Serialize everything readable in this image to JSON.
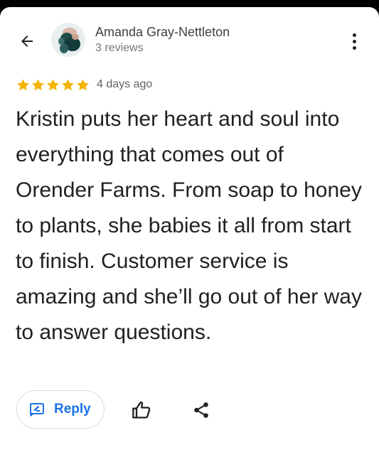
{
  "header": {
    "back_icon": "arrow-left-icon",
    "author_name": "Amanda Gray-Nettleton",
    "review_count": "3 reviews",
    "more_icon": "more-vertical-icon"
  },
  "review": {
    "rating": 5,
    "max_rating": 5,
    "date": "4 days ago",
    "text": "Kristin puts her heart and soul into everything that comes out of Orender Farms. From soap to honey to plants, she babies it all from start to finish. Customer service is amazing and she’ll go out of her way to answer questions."
  },
  "actions": {
    "reply_label": "Reply",
    "reply_icon": "reply-icon",
    "like_icon": "thumbs-up-icon",
    "share_icon": "share-icon"
  },
  "colors": {
    "star": "#f4b400",
    "accent": "#1a73e8",
    "text_primary": "#202124",
    "text_secondary": "#70757a"
  }
}
